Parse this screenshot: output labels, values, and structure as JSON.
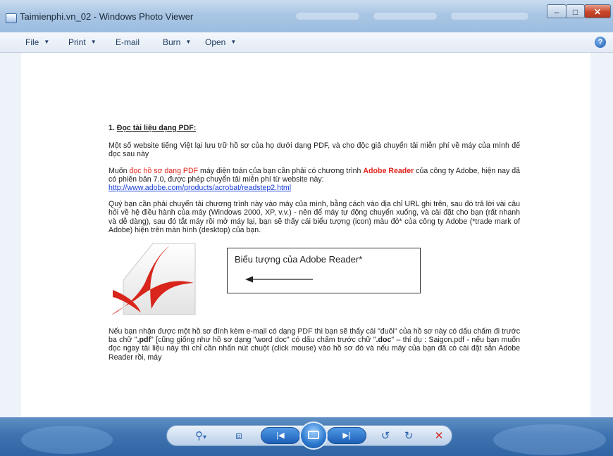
{
  "window": {
    "title": "Taimienphi.vn_02 - Windows Photo Viewer",
    "minimize_glyph": "–",
    "maximize_glyph": "□",
    "close_glyph": "✕"
  },
  "menu": {
    "items": [
      {
        "label": "File",
        "has_dropdown": true
      },
      {
        "label": "Print",
        "has_dropdown": true
      },
      {
        "label": "E-mail",
        "has_dropdown": false
      },
      {
        "label": "Burn",
        "has_dropdown": true
      },
      {
        "label": "Open",
        "has_dropdown": true
      }
    ],
    "help_icon": "help-icon",
    "help_glyph": "?"
  },
  "document": {
    "heading_number": "1.",
    "heading_text": "Đọc tài liệu dạng PDF:",
    "p1": "Một số website tiếng Việt lại lưu trữ hồ sơ của họ dưới dạng PDF, và cho độc giả chuyển tải miễn phí về máy của mình để đọc sau này",
    "p2_a": "Muốn ",
    "p2_red": "đọc hồ sơ dạng PDF",
    "p2_b": " máy điện toán của bạn cần phải có chương trình ",
    "p2_bold_red": "Adobe Reader",
    "p2_c": " của công ty Adobe, hiện nay đã có phiên bản 7.0, được phép chuyển tải miễn phí từ website này:",
    "p2_link": "http://www.adobe.com/products/acrobat/readstep2.html",
    "p3": "Quý bạn cần phải chuyển tải chương trình này vào máy của mình, bằng cách vào địa chỉ URL ghi trên, sau đó trả lời vài câu hỏi về hệ điều hành của máy (Windows 2000, XP, v.v.) - nên để máy tự động chuyển xuống, và cài đặt cho bạn (rất nhanh và dễ dàng), sau đó tắt máy rồi mở máy lại, bạn sẽ thấy cái biểu tượng (icon) màu đỏ* của công ty Adobe (*trade mark of Adobe) hiện trên màn hình (desktop) của bạn.",
    "callout": "Biểu tượng của Adobe Reader*",
    "p4_a": "Nếu bạn nhận được một hồ sơ đính kèm e-mail có dạng PDF thì bạn sẽ thấy cái \"đuôi\" của hồ sơ này có dấu chấm đi trước ba chữ \"",
    "p4_b1": ".pdf",
    "p4_c": "\" [cũng giống như hồ sơ dạng \"word doc\" có dấu chấm trước chữ \"",
    "p4_b2": ".doc",
    "p4_d": "\" – thí dụ : Saigon.pdf - nếu bạn muốn đọc ngay tài liệu này thì chỉ cần nhấn nút chuột (click mouse) vào hồ sơ đó và nếu máy của bạn đã có cài đặt sẵn Adobe Reader rồi, máy"
  },
  "controls": {
    "zoom": "zoom-icon",
    "zoom_glyph": "⚲",
    "zoom_dropdown_glyph": "▾",
    "actual_size": "fit-to-window-icon",
    "actual_size_glyph": "⧈",
    "previous": "previous-icon",
    "previous_glyph": "|◀",
    "slideshow": "slideshow-icon",
    "next": "next-icon",
    "next_glyph": "▶|",
    "rotate_ccw": "rotate-counterclockwise-icon",
    "rotate_ccw_glyph": "↺",
    "rotate_cw": "rotate-clockwise-icon",
    "rotate_cw_glyph": "↻",
    "delete": "delete-icon",
    "delete_glyph": "✕"
  },
  "colors": {
    "link": "#1a3fd6",
    "accent_red": "#e0231a",
    "taskbar_blue": "#2f64a4"
  }
}
